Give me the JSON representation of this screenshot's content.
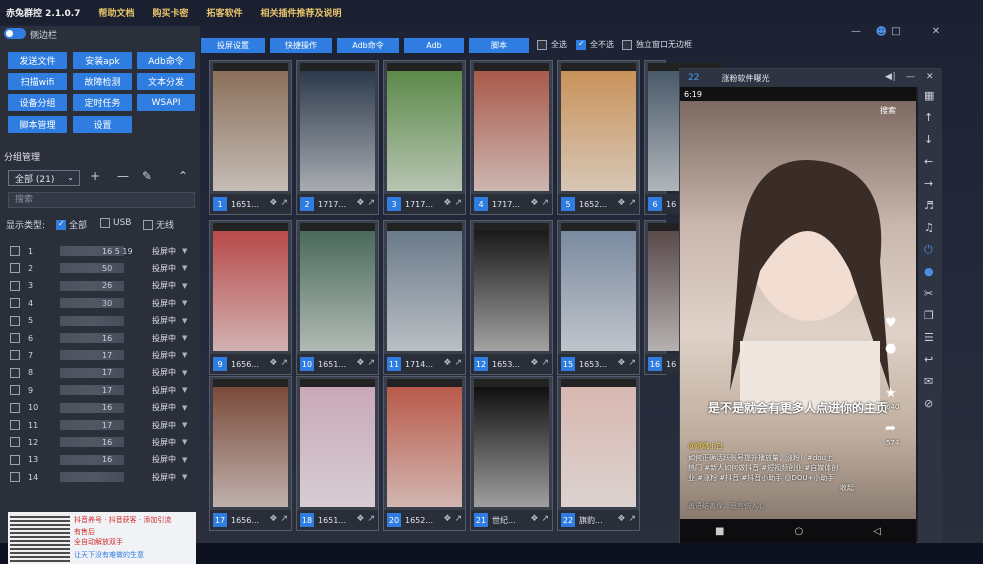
{
  "titlebar": {
    "app_title": "赤兔群控 2.1.0.7",
    "menu": [
      "帮助文档",
      "购买卡密",
      "拓客软件",
      "相关插件推荐及说明"
    ]
  },
  "sidebar": {
    "toggle_label": "侧边栏",
    "buttons": [
      "发送文件",
      "安装apk",
      "Adb命令",
      "扫描wifi",
      "故障检测",
      "文本分发",
      "设备分组",
      "定时任务",
      "WSAPI",
      "脚本管理",
      "设置"
    ],
    "group_title": "分组管理",
    "group_select": "全部 (21)",
    "search_placeholder": "搜索",
    "filter_label": "显示类型:",
    "filter_all": "全部",
    "filter_usb": "USB",
    "filter_wifi": "无线",
    "devices": [
      {
        "num": "1",
        "id": "16  5 19",
        "status": "投屏中"
      },
      {
        "num": "2",
        "id": "50",
        "status": "投屏中"
      },
      {
        "num": "3",
        "id": "26",
        "status": "投屏中"
      },
      {
        "num": "4",
        "id": "30",
        "status": "投屏中"
      },
      {
        "num": "5",
        "id": "",
        "status": "投屏中"
      },
      {
        "num": "6",
        "id": "16",
        "status": "投屏中"
      },
      {
        "num": "7",
        "id": "17",
        "status": "投屏中"
      },
      {
        "num": "8",
        "id": "17",
        "status": "投屏中"
      },
      {
        "num": "9",
        "id": "17",
        "status": "投屏中"
      },
      {
        "num": "10",
        "id": "16",
        "status": "投屏中"
      },
      {
        "num": "11",
        "id": "17",
        "status": "投屏中"
      },
      {
        "num": "12",
        "id": "16",
        "status": "投屏中"
      },
      {
        "num": "13",
        "id": "16",
        "status": "投屏中"
      },
      {
        "num": "14",
        "id": "",
        "status": "投屏中"
      }
    ],
    "promo": [
      "抖音养号 · 抖音获客 · 添加引流",
      "有售后",
      "全自动解放双手",
      "让天下没有难做的生意"
    ]
  },
  "toolbar": {
    "buttons": [
      "投屏设置",
      "快捷操作",
      "Adb命令",
      "Adb",
      "脚本"
    ],
    "select_all": "全选",
    "select_none": "全不选",
    "independent_window": "独立窗口无边框"
  },
  "tiles": [
    {
      "badge": "1",
      "label": "1651..."
    },
    {
      "badge": "2",
      "label": "1717..."
    },
    {
      "badge": "3",
      "label": "1717..."
    },
    {
      "badge": "4",
      "label": "1717..."
    },
    {
      "badge": "5",
      "label": "1652..."
    },
    {
      "badge": "6",
      "label": "16"
    },
    {
      "badge": "9",
      "label": "1656..."
    },
    {
      "badge": "10",
      "label": "1651..."
    },
    {
      "badge": "11",
      "label": "1714..."
    },
    {
      "badge": "12",
      "label": "1653..."
    },
    {
      "badge": "15",
      "label": "1653..."
    },
    {
      "badge": "16",
      "label": "16"
    },
    {
      "badge": "17",
      "label": "1656..."
    },
    {
      "badge": "18",
      "label": "1651..."
    },
    {
      "badge": "20",
      "label": "1652..."
    },
    {
      "badge": "21",
      "label": "世纪..."
    },
    {
      "badge": "22",
      "label": "旗豹..."
    }
  ],
  "phone": {
    "number": "22",
    "title": "涨粉软件曝光",
    "time": "6:19",
    "search_hint": "搜索",
    "caption": "是不是就会有更多人点进你的主页",
    "desc_lines": [
      "@跳跳小白",
      "如何正确活跃账号提升播放量，涨粉！#dou上",
      "热门 #新人如何做抖音 #短视频创业 #自媒体创",
      "业 #涨粉 #抖音 #抖音小助手 @DOU+小助手",
      "收起"
    ],
    "like_count": "640",
    "share_count": "574",
    "comment_hint": "善语结善缘，恶言伤人心"
  },
  "colors": {
    "accent": "#2f7de0",
    "menu_text": "#e8c36a",
    "panel_bg": "#2b2f3a"
  }
}
